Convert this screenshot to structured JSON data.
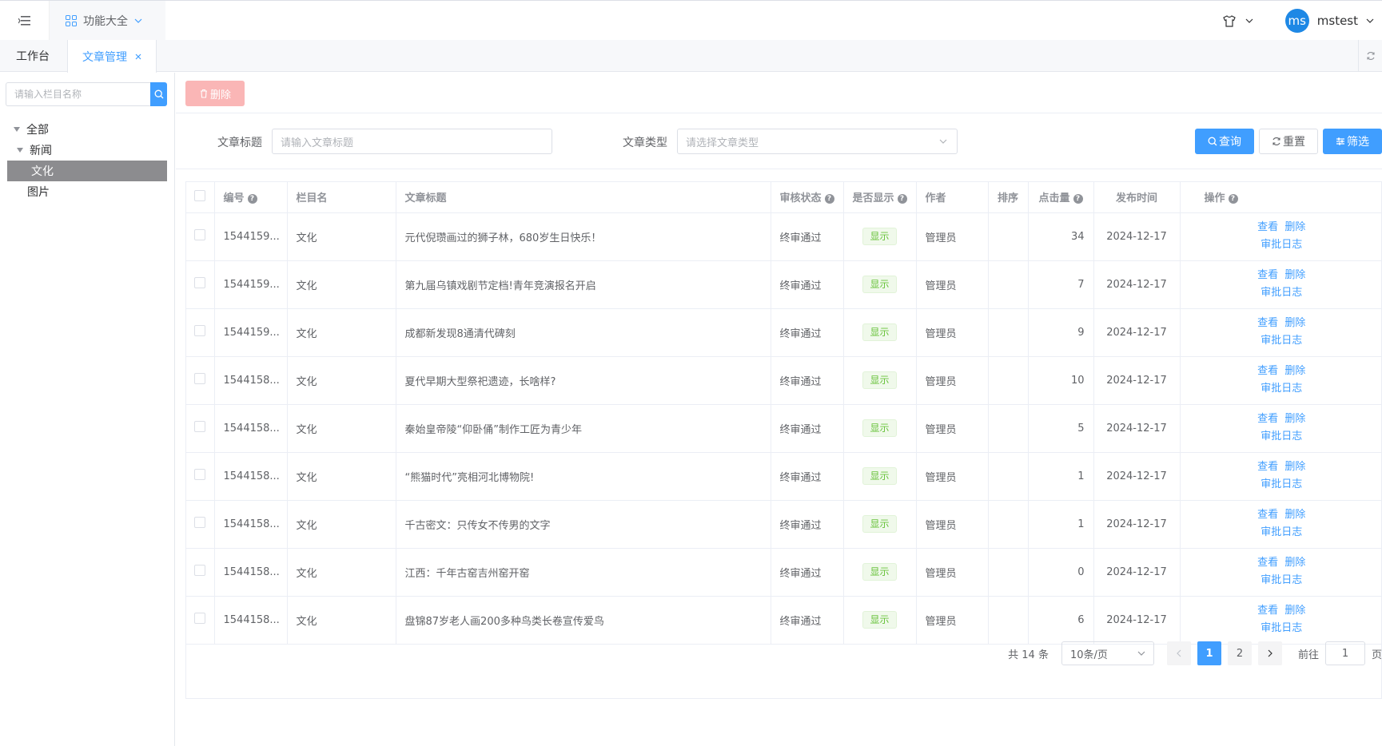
{
  "topbar": {
    "menu_label": "功能大全",
    "username": "mstest",
    "avatar_text": "ms"
  },
  "tabs": [
    {
      "label": "工作台"
    },
    {
      "label": "文章管理"
    }
  ],
  "sidebar": {
    "search_placeholder": "请输入栏目名称",
    "tree": [
      {
        "label": "全部"
      },
      {
        "label": "新闻"
      },
      {
        "label": "文化"
      },
      {
        "label": "图片"
      }
    ]
  },
  "toolbar": {
    "delete_label": "删除"
  },
  "filters": {
    "title_label": "文章标题",
    "title_placeholder": "请输入文章标题",
    "type_label": "文章类型",
    "type_placeholder": "请选择文章类型",
    "query_label": "查询",
    "reset_label": "重置",
    "filter_label": "筛选"
  },
  "table": {
    "columns": [
      "编号",
      "栏目名",
      "文章标题",
      "审核状态",
      "是否显示",
      "作者",
      "排序",
      "点击量",
      "发布时间",
      "操作"
    ],
    "rows": [
      {
        "id": "1544159...",
        "column": "文化",
        "title": "元代倪瓒画过的狮子林，680岁生日快乐！",
        "status": "终审通过",
        "show": "显示",
        "author": "管理员",
        "sort": "",
        "clicks": "34",
        "date": "2024-12-17"
      },
      {
        "id": "1544159...",
        "column": "文化",
        "title": "第九届乌镇戏剧节定档!青年竞演报名开启",
        "status": "终审通过",
        "show": "显示",
        "author": "管理员",
        "sort": "",
        "clicks": "7",
        "date": "2024-12-17"
      },
      {
        "id": "1544159...",
        "column": "文化",
        "title": "成都新发现8通清代碑刻",
        "status": "终审通过",
        "show": "显示",
        "author": "管理员",
        "sort": "",
        "clicks": "9",
        "date": "2024-12-17"
      },
      {
        "id": "1544158...",
        "column": "文化",
        "title": "夏代早期大型祭祀遗迹，长啥样?",
        "status": "终审通过",
        "show": "显示",
        "author": "管理员",
        "sort": "",
        "clicks": "10",
        "date": "2024-12-17"
      },
      {
        "id": "1544158...",
        "column": "文化",
        "title": "秦始皇帝陵“仰卧俑”制作工匠为青少年",
        "status": "终审通过",
        "show": "显示",
        "author": "管理员",
        "sort": "",
        "clicks": "5",
        "date": "2024-12-17"
      },
      {
        "id": "1544158...",
        "column": "文化",
        "title": "“熊猫时代”亮相河北博物院!",
        "status": "终审通过",
        "show": "显示",
        "author": "管理员",
        "sort": "",
        "clicks": "1",
        "date": "2024-12-17"
      },
      {
        "id": "1544158...",
        "column": "文化",
        "title": "千古密文：只传女不传男的文字",
        "status": "终审通过",
        "show": "显示",
        "author": "管理员",
        "sort": "",
        "clicks": "1",
        "date": "2024-12-17"
      },
      {
        "id": "1544158...",
        "column": "文化",
        "title": "江西：千年古窑吉州窑开窑",
        "status": "终审通过",
        "show": "显示",
        "author": "管理员",
        "sort": "",
        "clicks": "0",
        "date": "2024-12-17"
      },
      {
        "id": "1544158...",
        "column": "文化",
        "title": "盘锦87岁老人画200多种鸟类长卷宣传爱鸟",
        "status": "终审通过",
        "show": "显示",
        "author": "管理员",
        "sort": "",
        "clicks": "6",
        "date": "2024-12-17"
      }
    ],
    "ops": {
      "view": "查看",
      "delete": "删除",
      "log": "审批日志"
    }
  },
  "pagination": {
    "total_text": "共 14 条",
    "page_size": "10条/页",
    "pages": [
      "1",
      "2"
    ],
    "current": "1",
    "goto_label": "前往",
    "goto_value": "1",
    "page_suffix": "页"
  },
  "colors": {
    "primary": "#409eff",
    "danger_disabled": "#fab6b6",
    "success": "#67c23a"
  }
}
